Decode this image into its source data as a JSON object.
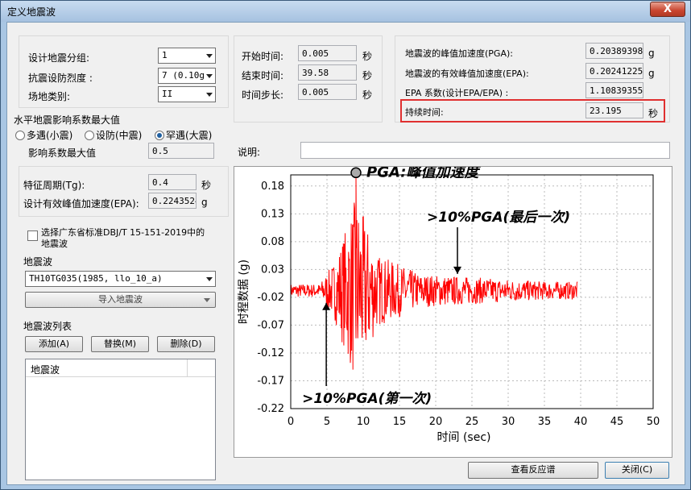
{
  "window": {
    "title": "定义地震波",
    "close_label": "X"
  },
  "left": {
    "seismic_group_label": "设计地震分组:",
    "seismic_group_value": "1",
    "intensity_label": "抗震设防烈度 :",
    "intensity_value": "7 (0.10g",
    "site_class_label": "场地类别:",
    "site_class_value": "II",
    "horizontal_group_title": "水平地震影响系数最大值",
    "radio_minor": "多遇(小震)",
    "radio_design": "设防(中震)",
    "radio_rare": "罕遇(大震)",
    "coef_max_label": "影响系数最大值",
    "coef_max_value": "0.5",
    "tg_label": "特征周期(Tg):",
    "tg_value": "0.4",
    "tg_unit": "秒",
    "epa_label": "设计有效峰值加速度(EPA):",
    "epa_value": "0.2243524",
    "epa_unit": "g",
    "gd_checkbox_label_line1": "选择广东省标准DBJ/T 15-151-2019中的",
    "gd_checkbox_label_line2": "地震波",
    "wave_group_title": "地震波",
    "wave_value": "TH10TG035(1985, llo_10_a)",
    "import_label": "导入地震波",
    "wave_list_title": "地震波列表",
    "add_label": "添加(A)",
    "replace_label": "替换(M)",
    "delete_label": "删除(D)",
    "list_header": "地震波"
  },
  "time": {
    "start_label": "开始时间:",
    "start_value": "0.005",
    "end_label": "结束时间:",
    "end_value": "39.58",
    "step_label": "时间步长:",
    "step_value": "0.005",
    "unit": "秒"
  },
  "peak": {
    "pga_label": "地震波的峰值加速度(PGA):",
    "pga_value": "0.20389398€",
    "pga_unit": "g",
    "epa_label": "地震波的有效峰值加速度(EPA):",
    "epa_value": "0.2024122548",
    "epa_unit": "g",
    "ratio_label": "EPA 系数(设计EPA/EPA) :",
    "ratio_value": "1.108393553",
    "duration_label": "持续时间:",
    "duration_value": "23.195",
    "duration_unit": "秒"
  },
  "desc_label": "说明:",
  "desc_value": "",
  "buttons": {
    "view_spectrum": "查看反应谱",
    "close": "关闭(C)"
  },
  "chart_data": {
    "type": "line",
    "xlabel": "时间 (sec)",
    "ylabel": "时程数据 (g)",
    "xlim": [
      0,
      50
    ],
    "ylim": [
      -0.22,
      0.2
    ],
    "xticks": [
      0,
      5,
      10,
      15,
      20,
      25,
      30,
      35,
      40,
      45,
      50
    ],
    "yticks": [
      0.18,
      0.13,
      0.08,
      0.03,
      -0.02,
      -0.07,
      -0.12,
      -0.17,
      -0.22
    ],
    "line_color": "#ff0000",
    "x_end": 39.58,
    "pga_point": {
      "x": 9.0,
      "y": 0.2039
    },
    "annotations": {
      "pga": "PGA:峰值加速度",
      "first": ">10%PGA(第一次)",
      "last": ">10%PGA(最后一次)"
    },
    "first_exceed_x": 4.9,
    "last_exceed_x": 23.0
  }
}
